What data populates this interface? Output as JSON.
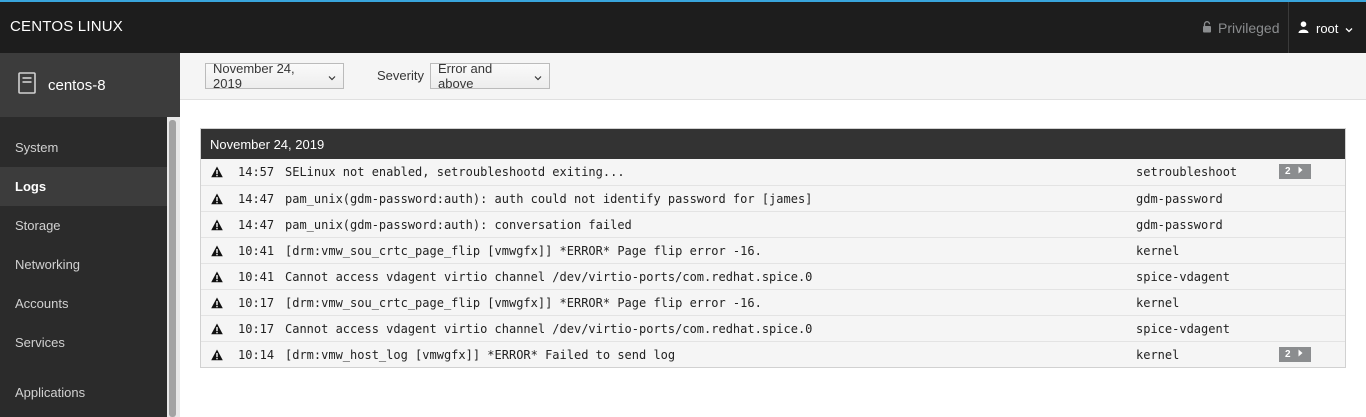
{
  "masthead": {
    "brand": "CENTOS LINUX",
    "privileged": "Privileged",
    "user": "root"
  },
  "sidebar": {
    "host": "centos-8",
    "items": [
      {
        "label": "System"
      },
      {
        "label": "Logs"
      },
      {
        "label": "Storage"
      },
      {
        "label": "Networking"
      },
      {
        "label": "Accounts"
      },
      {
        "label": "Services"
      },
      {
        "label": "Applications"
      }
    ]
  },
  "toolbar": {
    "date": "November 24, 2019",
    "severity_label": "Severity",
    "severity": "Error and above"
  },
  "logs": {
    "group_date": "November 24, 2019",
    "entries": [
      {
        "time": "14:57",
        "message": "SELinux not enabled, setroubleshootd exiting...",
        "identifier": "setroubleshoot",
        "count": "2"
      },
      {
        "time": "14:47",
        "message": "pam_unix(gdm-password:auth): auth could not identify password for [james]",
        "identifier": "gdm-password",
        "count": ""
      },
      {
        "time": "14:47",
        "message": "pam_unix(gdm-password:auth): conversation failed",
        "identifier": "gdm-password",
        "count": ""
      },
      {
        "time": "10:41",
        "message": "[drm:vmw_sou_crtc_page_flip [vmwgfx]] *ERROR* Page flip error -16.",
        "identifier": "kernel",
        "count": ""
      },
      {
        "time": "10:41",
        "message": "Cannot access vdagent virtio channel /dev/virtio-ports/com.redhat.spice.0",
        "identifier": "spice-vdagent",
        "count": ""
      },
      {
        "time": "10:17",
        "message": "[drm:vmw_sou_crtc_page_flip [vmwgfx]] *ERROR* Page flip error -16.",
        "identifier": "kernel",
        "count": ""
      },
      {
        "time": "10:17",
        "message": "Cannot access vdagent virtio channel /dev/virtio-ports/com.redhat.spice.0",
        "identifier": "spice-vdagent",
        "count": ""
      },
      {
        "time": "10:14",
        "message": "[drm:vmw_host_log [vmwgfx]] *ERROR* Failed to send log",
        "identifier": "kernel",
        "count": "2"
      }
    ]
  },
  "colors": {
    "masthead": "#1d1d1d",
    "accent": "#39a5dc",
    "sidebar": "#2b2b2b"
  },
  "icons": {
    "lock": "lock-icon",
    "user": "user-icon",
    "server": "server-icon",
    "warning": "warning-icon",
    "chevron": "chevron-down-icon"
  }
}
